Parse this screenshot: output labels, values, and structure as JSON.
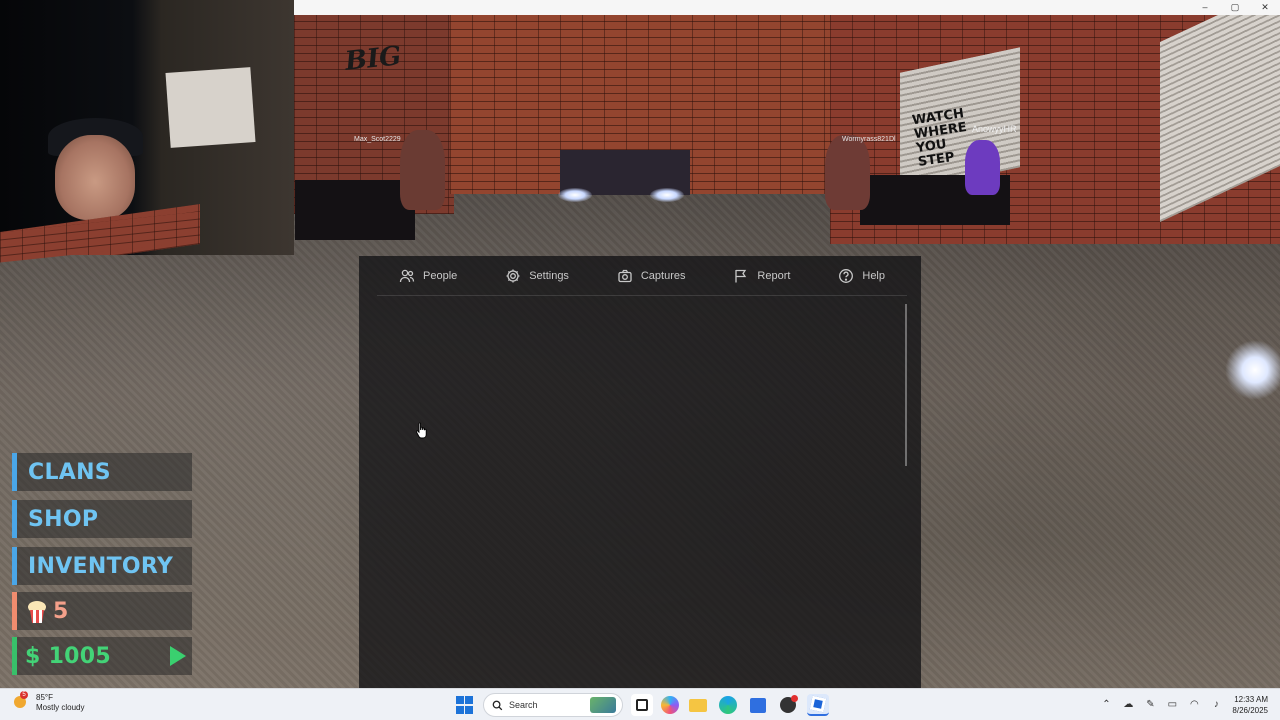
{
  "window": {
    "minimize": "–",
    "maximize": "▢",
    "close": "✕"
  },
  "scene": {
    "graffiti_big": "BIG",
    "graffiti_wall": "WATCH WHERE YOU STEP",
    "player_tags": [
      "Max_Scot2229",
      "Wormyrass821Dl",
      "AnowyyHR"
    ]
  },
  "menu": {
    "tabs": [
      {
        "label": "People",
        "icon": "people-icon"
      },
      {
        "label": "Settings",
        "icon": "gear-icon"
      },
      {
        "label": "Captures",
        "icon": "camera-icon"
      },
      {
        "label": "Report",
        "icon": "flag-icon"
      },
      {
        "label": "Help",
        "icon": "help-icon"
      }
    ]
  },
  "hud": {
    "clans": "CLANS",
    "shop": "SHOP",
    "inventory": "INVENTORY",
    "popcorn_count": "5",
    "money": "$ 1005",
    "colors": {
      "nav": "#6fc4f2",
      "popcorn": "#f4a08a",
      "money": "#43d377"
    }
  },
  "taskbar": {
    "weather_temp": "85°F",
    "weather_desc": "Mostly cloudy",
    "weather_badge": "5",
    "search_placeholder": "Search",
    "time": "12:33 AM",
    "date": "8/26/2025",
    "pinned": [
      "file-explorer-icon",
      "copilot-icon",
      "folder-icon",
      "chrome-icon",
      "store-icon",
      "roblox-studio-icon",
      "roblox-icon"
    ]
  }
}
